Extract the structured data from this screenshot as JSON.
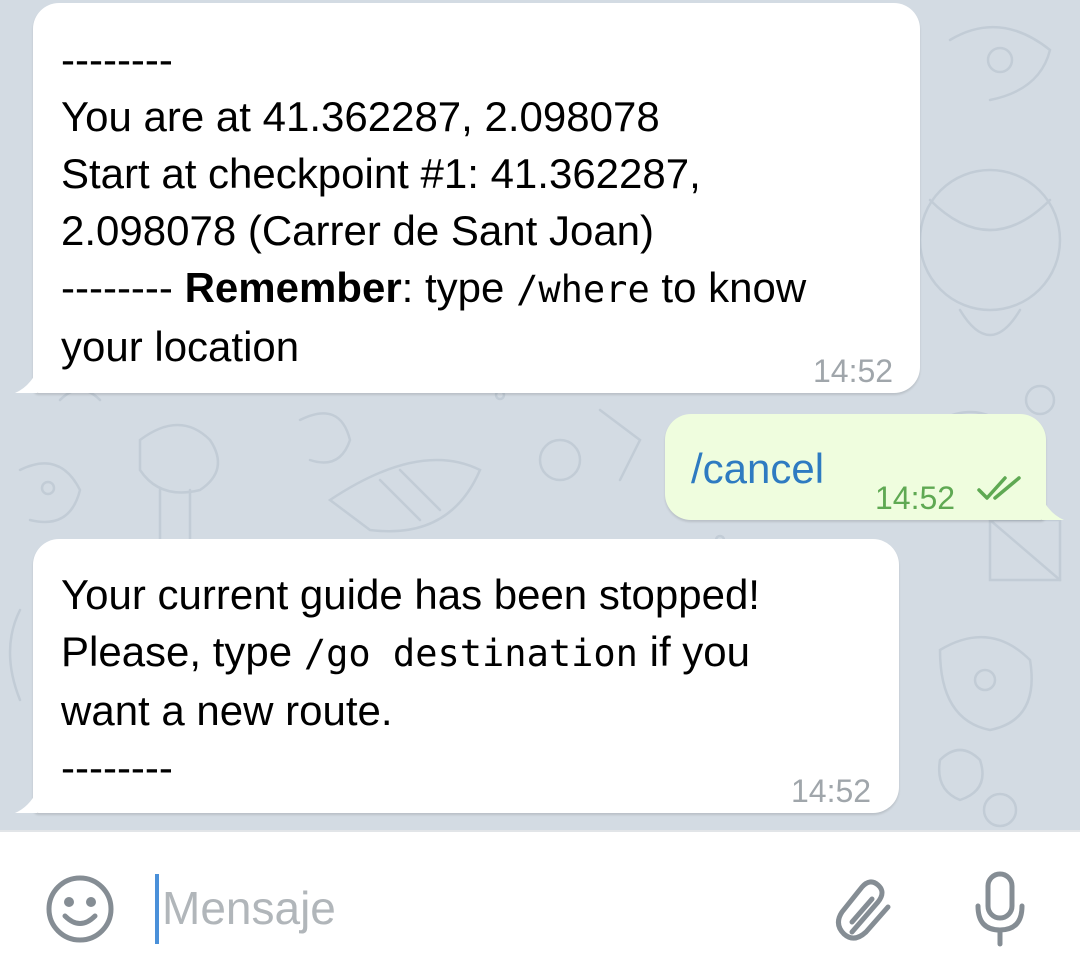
{
  "messages": [
    {
      "direction": "incoming",
      "lines": {
        "sep_top": "--------",
        "location_prefix": "You are at ",
        "location_value": "41.362287, 2.098078",
        "checkpoint_line1": "Start at checkpoint #1: 41.362287,",
        "checkpoint_line2": "2.098078 (Carrer de Sant Joan)",
        "sep_inline": "-------- ",
        "remember_bold": "Remember",
        "remember_after_bold": ": type ",
        "remember_cmd": "/where",
        "remember_tail": " to know",
        "remember_line2": "your location"
      },
      "time": "14:52"
    },
    {
      "direction": "outgoing",
      "text": "/cancel",
      "time": "14:52",
      "status": "read-double-check-icon"
    },
    {
      "direction": "incoming",
      "lines": {
        "line1": "Your current guide has been stopped!",
        "line2_prefix": "Please, type ",
        "line2_cmd": "/go destination",
        "line2_suffix": " if you",
        "line3": "want a new route.",
        "sep_bottom": "--------"
      },
      "time": "14:52"
    }
  ],
  "input_bar": {
    "placeholder": "Mensaje",
    "emoji_icon": "smiley-icon",
    "attach_icon": "paperclip-icon",
    "mic_icon": "microphone-icon"
  },
  "colors": {
    "chat_background": "#d3dbe3",
    "incoming_bubble": "#ffffff",
    "outgoing_bubble": "#effdde",
    "outgoing_time": "#5fa953",
    "command_link": "#2e7bc1",
    "caret": "#4a90d9"
  }
}
